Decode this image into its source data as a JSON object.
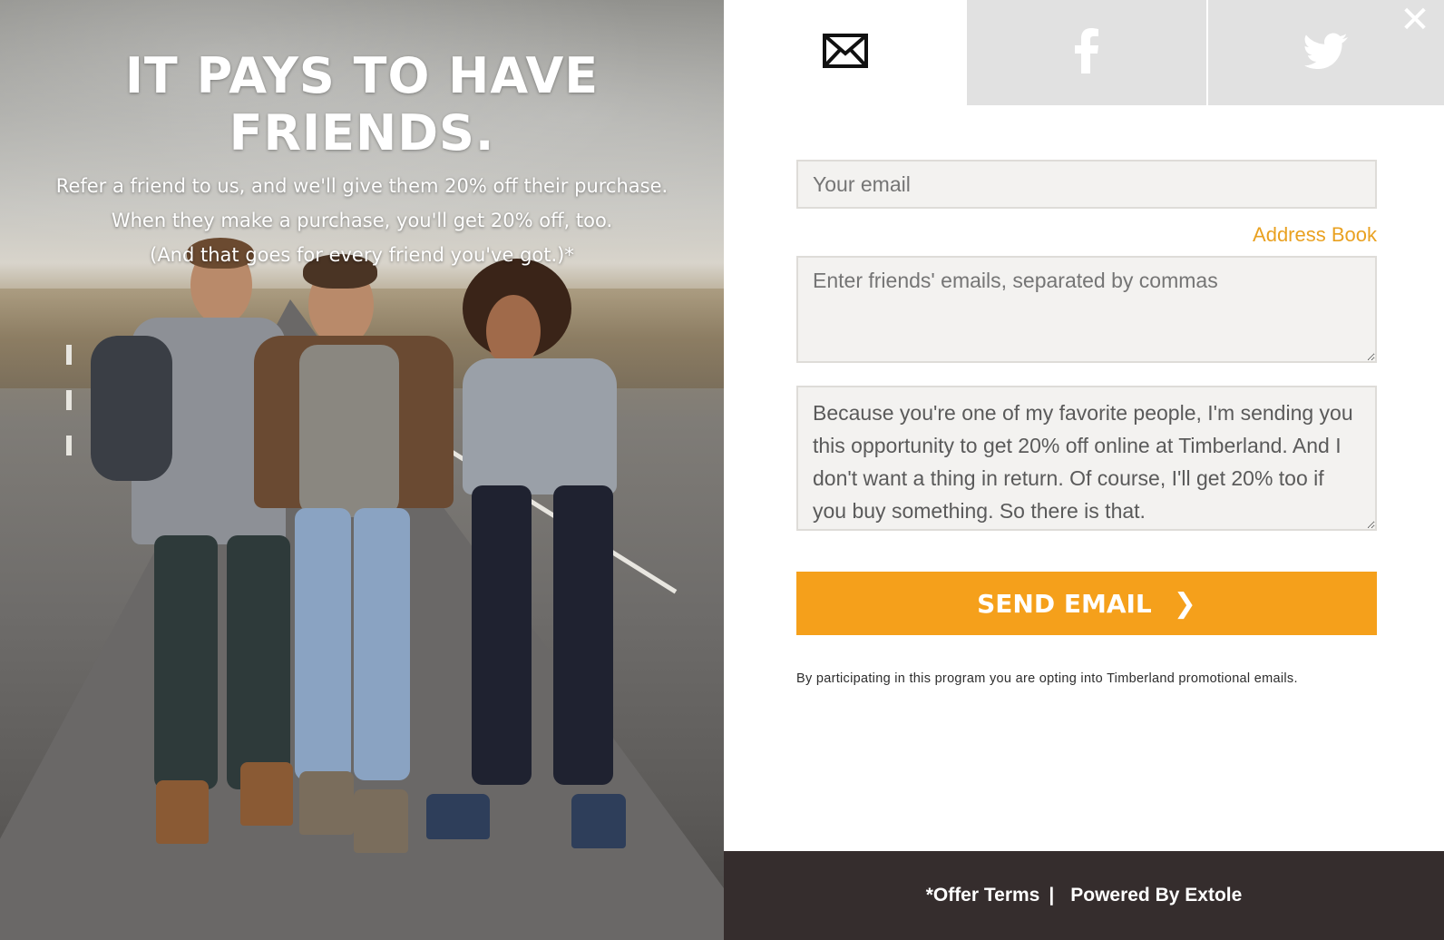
{
  "hero": {
    "title": "IT PAYS TO HAVE FRIENDS.",
    "lines": [
      "Refer a friend to us, and we'll give them 20% off their purchase.",
      "When they make a purchase, you'll get 20% off, too.",
      "(And that goes for every friend you've got.)*"
    ]
  },
  "tabs": [
    {
      "name": "email",
      "icon": "envelope-icon",
      "active": true
    },
    {
      "name": "facebook",
      "icon": "facebook-icon",
      "active": false
    },
    {
      "name": "twitter",
      "icon": "twitter-icon",
      "active": false
    }
  ],
  "close_label": "✕",
  "form": {
    "email_placeholder": "Your email",
    "address_book_label": "Address Book",
    "friends_placeholder": "Enter friends' emails, separated by commas",
    "message": "Because you're one of my favorite people, I'm sending you this opportunity to get 20% off online at Timberland. And I don't want a thing in return. Of course, I'll get 20% too if you buy something. So there is that.",
    "send_label": "SEND EMAIL",
    "send_chevron": "❯",
    "disclaimer": "By participating in this program you are opting into Timberland promotional emails."
  },
  "footer": {
    "offer_terms": "*Offer Terms",
    "separator": "|",
    "powered_by": "Powered By Extole"
  },
  "colors": {
    "accent": "#f5a01b",
    "link": "#e9a121",
    "footer_bg": "#352d2d",
    "tab_inactive": "#e1e1e1"
  }
}
